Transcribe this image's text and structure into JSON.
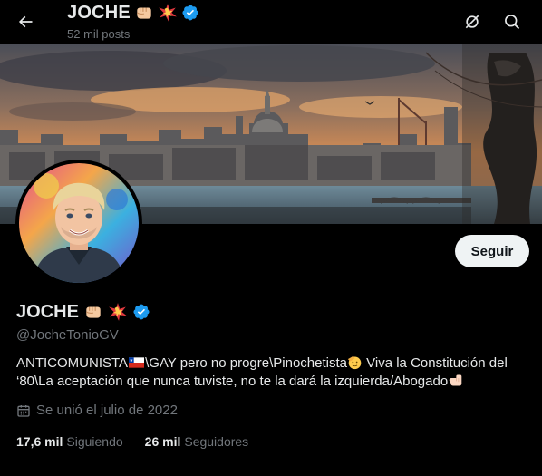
{
  "header": {
    "display_name": "JOCHE",
    "posts_count": "52 mil posts"
  },
  "banner": {
    "scene": "London skyline with St Paul's Cathedral at sunset"
  },
  "profile": {
    "display_name": "JOCHE",
    "handle": "@JocheTonioGV",
    "verified": true,
    "bio_parts": {
      "p1": "ANTICOMUNISTA",
      "p2": "\\GAY pero no progre\\Pinochetista",
      "p3": " Viva la Constitución del ‘80\\La aceptación que nunca tuviste, no te la dará la izquierda/Abogado"
    },
    "joined": "Se unió el julio de 2022",
    "following_count": "17,6 mil",
    "following_label": "Siguiendo",
    "followers_count": "26 mil",
    "followers_label": "Seguidores"
  },
  "actions": {
    "follow_label": "Seguir"
  },
  "colors": {
    "verified_blue": "#1d9bf0",
    "muted_text": "#71767b",
    "button_bg": "#eff3f4"
  }
}
